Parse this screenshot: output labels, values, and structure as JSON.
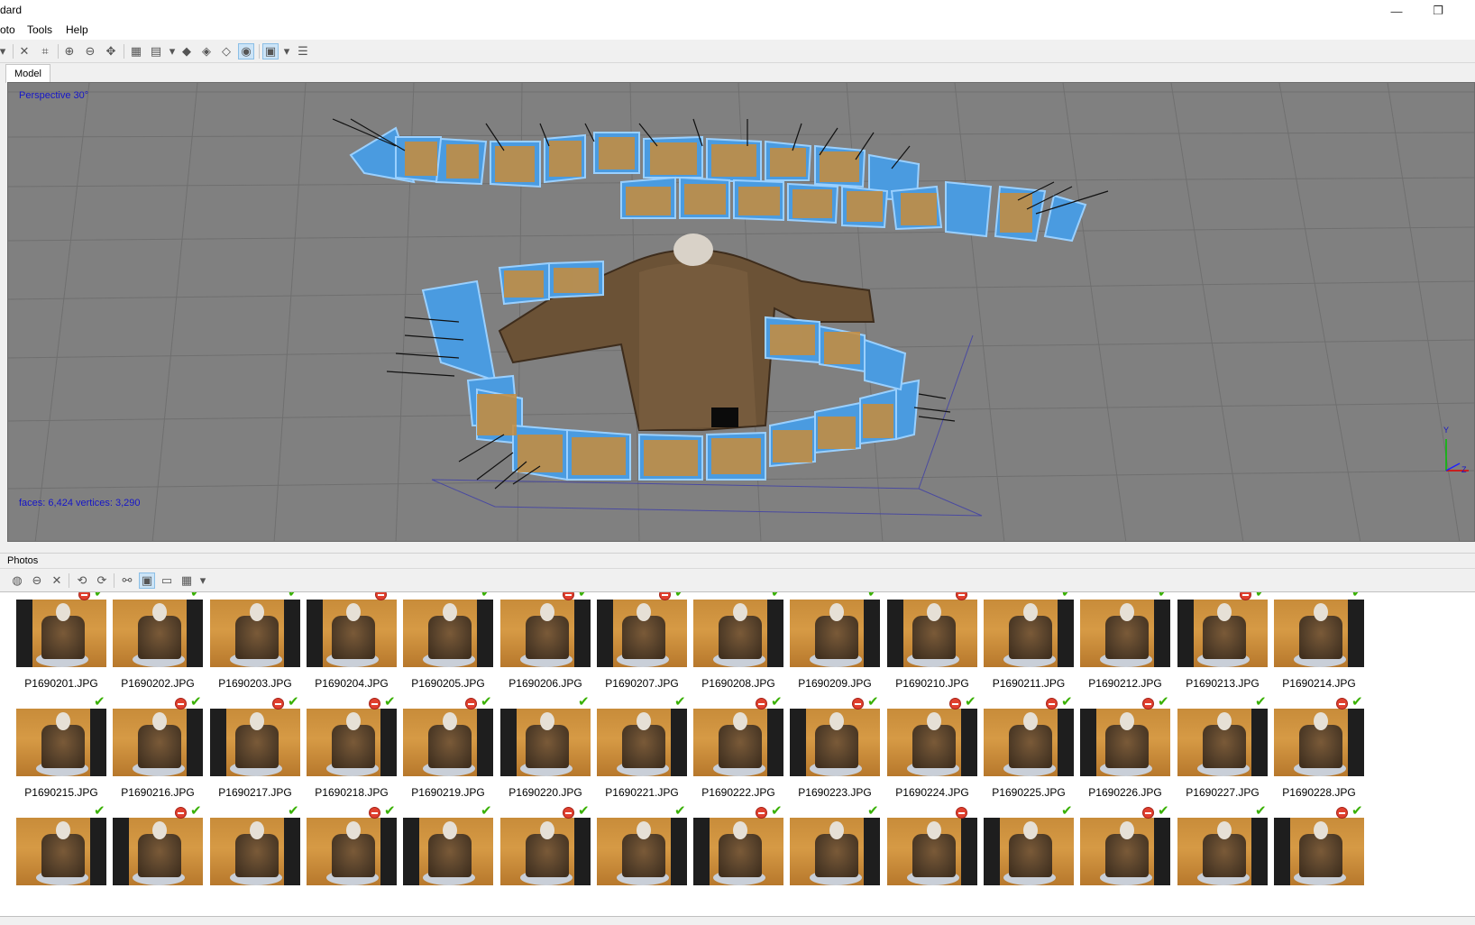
{
  "window": {
    "title": "dard",
    "minimize_glyph": "—",
    "restore_glyph": "❐"
  },
  "menu": [
    "oto",
    "Tools",
    "Help"
  ],
  "model_tab": {
    "label": "Model"
  },
  "viewport": {
    "projection_label": "Perspective 30°",
    "stats_label": "faces: 6,424 vertices: 3,290",
    "axis_labels": {
      "y": "Y",
      "z": "Z"
    }
  },
  "photos_panel": {
    "title": "Photos",
    "rows": [
      {
        "photos": [
          {
            "name": "P1690201.JPG",
            "marks": [
              "disabled",
              "aligned"
            ]
          },
          {
            "name": "P1690202.JPG",
            "marks": [
              "aligned"
            ]
          },
          {
            "name": "P1690203.JPG",
            "marks": [
              "aligned"
            ]
          },
          {
            "name": "P1690204.JPG",
            "marks": [
              "disabled"
            ]
          },
          {
            "name": "P1690205.JPG",
            "marks": [
              "aligned"
            ]
          },
          {
            "name": "P1690206.JPG",
            "marks": [
              "disabled",
              "aligned"
            ]
          },
          {
            "name": "P1690207.JPG",
            "marks": [
              "disabled",
              "aligned"
            ]
          },
          {
            "name": "P1690208.JPG",
            "marks": [
              "aligned"
            ]
          },
          {
            "name": "P1690209.JPG",
            "marks": [
              "aligned"
            ]
          },
          {
            "name": "P1690210.JPG",
            "marks": [
              "disabled"
            ]
          },
          {
            "name": "P1690211.JPG",
            "marks": [
              "aligned"
            ]
          },
          {
            "name": "P1690212.JPG",
            "marks": [
              "aligned"
            ]
          },
          {
            "name": "P1690213.JPG",
            "marks": [
              "disabled",
              "aligned"
            ]
          },
          {
            "name": "P1690214.JPG",
            "marks": [
              "aligned"
            ]
          }
        ]
      },
      {
        "photos": [
          {
            "name": "P1690215.JPG",
            "marks": [
              "aligned"
            ]
          },
          {
            "name": "P1690216.JPG",
            "marks": [
              "disabled",
              "aligned"
            ]
          },
          {
            "name": "P1690217.JPG",
            "marks": [
              "disabled",
              "aligned"
            ]
          },
          {
            "name": "P1690218.JPG",
            "marks": [
              "disabled",
              "aligned"
            ]
          },
          {
            "name": "P1690219.JPG",
            "marks": [
              "disabled",
              "aligned"
            ]
          },
          {
            "name": "P1690220.JPG",
            "marks": [
              "aligned"
            ]
          },
          {
            "name": "P1690221.JPG",
            "marks": [
              "aligned"
            ]
          },
          {
            "name": "P1690222.JPG",
            "marks": [
              "disabled",
              "aligned"
            ]
          },
          {
            "name": "P1690223.JPG",
            "marks": [
              "disabled",
              "aligned"
            ]
          },
          {
            "name": "P1690224.JPG",
            "marks": [
              "disabled",
              "aligned"
            ]
          },
          {
            "name": "P1690225.JPG",
            "marks": [
              "disabled",
              "aligned"
            ]
          },
          {
            "name": "P1690226.JPG",
            "marks": [
              "disabled",
              "aligned"
            ]
          },
          {
            "name": "P1690227.JPG",
            "marks": [
              "aligned"
            ]
          },
          {
            "name": "P1690228.JPG",
            "marks": [
              "disabled",
              "aligned"
            ]
          }
        ]
      },
      {
        "photos": [
          {
            "name": "",
            "marks": [
              "aligned"
            ]
          },
          {
            "name": "",
            "marks": [
              "disabled",
              "aligned"
            ]
          },
          {
            "name": "",
            "marks": [
              "aligned"
            ]
          },
          {
            "name": "",
            "marks": [
              "disabled",
              "aligned"
            ]
          },
          {
            "name": "",
            "marks": [
              "aligned"
            ]
          },
          {
            "name": "",
            "marks": [
              "disabled",
              "aligned"
            ]
          },
          {
            "name": "",
            "marks": [
              "aligned"
            ]
          },
          {
            "name": "",
            "marks": [
              "disabled",
              "aligned"
            ]
          },
          {
            "name": "",
            "marks": [
              "aligned"
            ]
          },
          {
            "name": "",
            "marks": [
              "disabled"
            ]
          },
          {
            "name": "",
            "marks": [
              "aligned"
            ]
          },
          {
            "name": "",
            "marks": [
              "disabled",
              "aligned"
            ]
          },
          {
            "name": "",
            "marks": [
              "aligned"
            ]
          },
          {
            "name": "",
            "marks": [
              "disabled",
              "aligned"
            ]
          }
        ]
      }
    ]
  },
  "colors": {
    "viewport_bg": "#808080",
    "overlay_text": "#1515c8",
    "camera_blue": "#4a9be0",
    "aligned_check": "#38b000",
    "disabled_mark": "#e0402e"
  }
}
